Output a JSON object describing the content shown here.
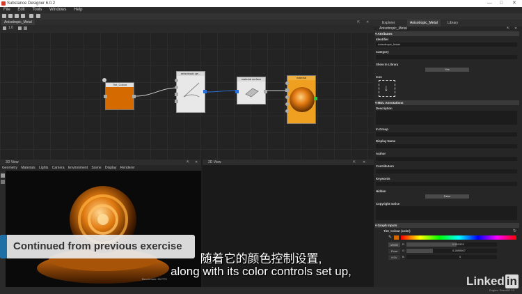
{
  "window": {
    "title": "Substance Designer 6.0.2"
  },
  "menu": [
    "File",
    "Edit",
    "Tools",
    "Windows",
    "Help"
  ],
  "graph_tab": {
    "label": "Anisotropic_Metal"
  },
  "graph_tool": {
    "zoom": "1.0"
  },
  "nodes": {
    "tint": {
      "label": "Tint_Colour"
    },
    "aniso": {
      "label": "anisotropic ge..."
    },
    "material": {
      "label": "material surface"
    },
    "output": {
      "label": "material"
    }
  },
  "view3d": {
    "tab": "3D View",
    "menu": [
      "Geometry",
      "Materials",
      "Lights",
      "Camera",
      "Environment",
      "Scene",
      "Display",
      "Renderer"
    ],
    "caption": "Benchmark: 30 FPS"
  },
  "view2d": {
    "tab": "2D View"
  },
  "right_panel": {
    "tabs": [
      "Explorer",
      "Anisotropic_Metal",
      "Library"
    ],
    "breadcrumb": "Anisotropic_Metal",
    "attributes_header": "Attributes",
    "identifier_label": "Identifier",
    "identifier_value": "Anisotropic_Metal",
    "category_label": "Category",
    "show_in_library_label": "Show In Library",
    "show_in_library_value": "Yes",
    "icon_label": "Icon",
    "mdl_header": "MDL Annotations",
    "description_label": "Description",
    "in_group_label": "In Group",
    "display_name_label": "Display Name",
    "author_label": "Author",
    "contributors_label": "Contributors",
    "keywords_label": "Keywords",
    "hidden_label": "Hidden",
    "hidden_value": "False",
    "copyright_label": "Copyright notice",
    "graph_inputs_header": "Graph Inputs",
    "input_name": "Tint_Colour (color)",
    "srgb_label": "sRGB",
    "float_label": "Float",
    "hsv_label": "HSV",
    "r_label": "R",
    "g_label": "G",
    "b_label": "B",
    "r_value": "0.553333",
    "g_value": "0.2890607",
    "b_value": "0"
  },
  "status": {
    "engine": "Engine: Direct3D 10"
  },
  "overlay": {
    "banner": "Continued from previous exercise",
    "subtitle_cn": "随着它的颜色控制设置,",
    "subtitle_en": "along with its color controls set up,"
  },
  "brand": {
    "linked": "Linked",
    "in": "in"
  },
  "colors": {
    "tint": "#d46a00",
    "output": "#f0a020",
    "accent": "#1d6fa5"
  }
}
